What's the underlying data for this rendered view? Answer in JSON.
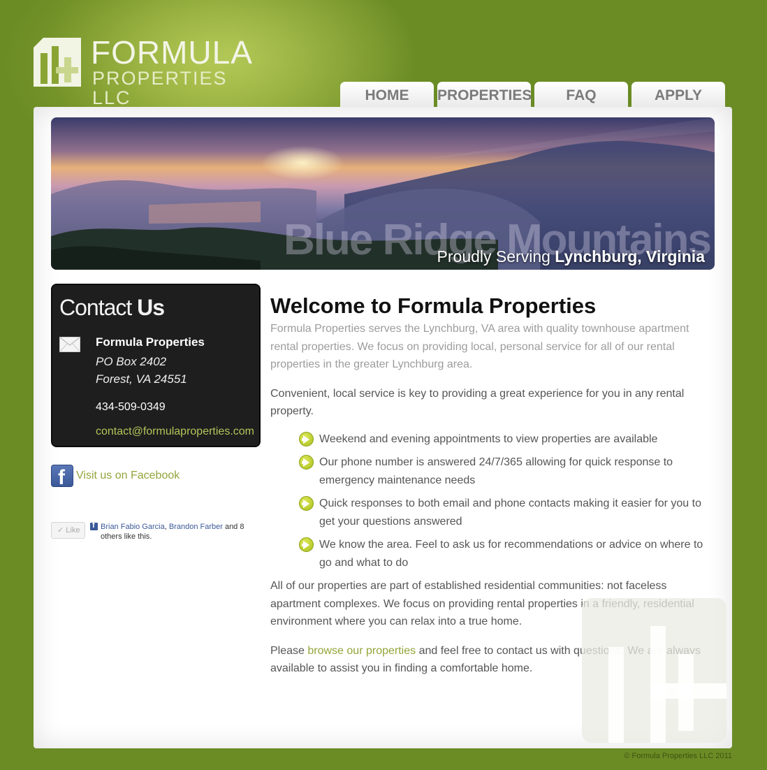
{
  "logo": {
    "line1": "FORMULA",
    "line2": "PROPERTIES LLC"
  },
  "nav": [
    {
      "label": "HOME"
    },
    {
      "label": "PROPERTIES"
    },
    {
      "label": "FAQ"
    },
    {
      "label": "APPLY"
    }
  ],
  "banner": {
    "watermark": "Blue Ridge Mountains",
    "tagline_prefix": "Proudly Serving ",
    "tagline_bold": "Lynchburg, Virginia"
  },
  "contact": {
    "title_light": "Contact ",
    "title_bold": "Us",
    "name": "Formula Properties",
    "address1": "PO Box 2402",
    "address2": "Forest, VA 24551",
    "phone": "434-509-0349",
    "email": "contact@formulaproperties.com"
  },
  "facebook": {
    "link": "Visit us on Facebook",
    "like_button": "Like",
    "friend1": "Brian Fabio Garcia",
    "sep": ", ",
    "friend2": "Brandon Farber",
    "rest": " and 8 others like this."
  },
  "main": {
    "title": "Welcome to Formula Properties",
    "intro": "Formula Properties serves the Lynchburg, VA area with quality townhouse apartment rental properties. We focus on providing local, personal service for all of our rental properties in the greater Lynchburg area.",
    "para1": "Convenient, local service is key to providing a great experience for you in any rental property.",
    "bullets": [
      "Weekend and evening appointments to view properties are available",
      "Our phone number is answered 24/7/365 allowing for quick response to emergency maintenance needs",
      "Quick responses to both email and phone contacts making it easier for you to get your questions answered",
      "We know the area. Feel to ask us for recommendations or advice on where to go and what to do"
    ],
    "para2": "All of our properties are part of established residential communities: not faceless apartment complexes. We focus on providing rental properties in a friendly, residential environment where you can relax into a true home.",
    "para3_before": "Please ",
    "para3_link": "browse our properties",
    "para3_after": " and feel free to contact us with questions. We are always available to assist you in finding a comfortable home."
  },
  "footer": "© Formula Properties LLC 2011",
  "colors": {
    "brand_green": "#6b8b27",
    "accent_green": "#93a53a",
    "contact_bg": "#1e1e1e"
  }
}
